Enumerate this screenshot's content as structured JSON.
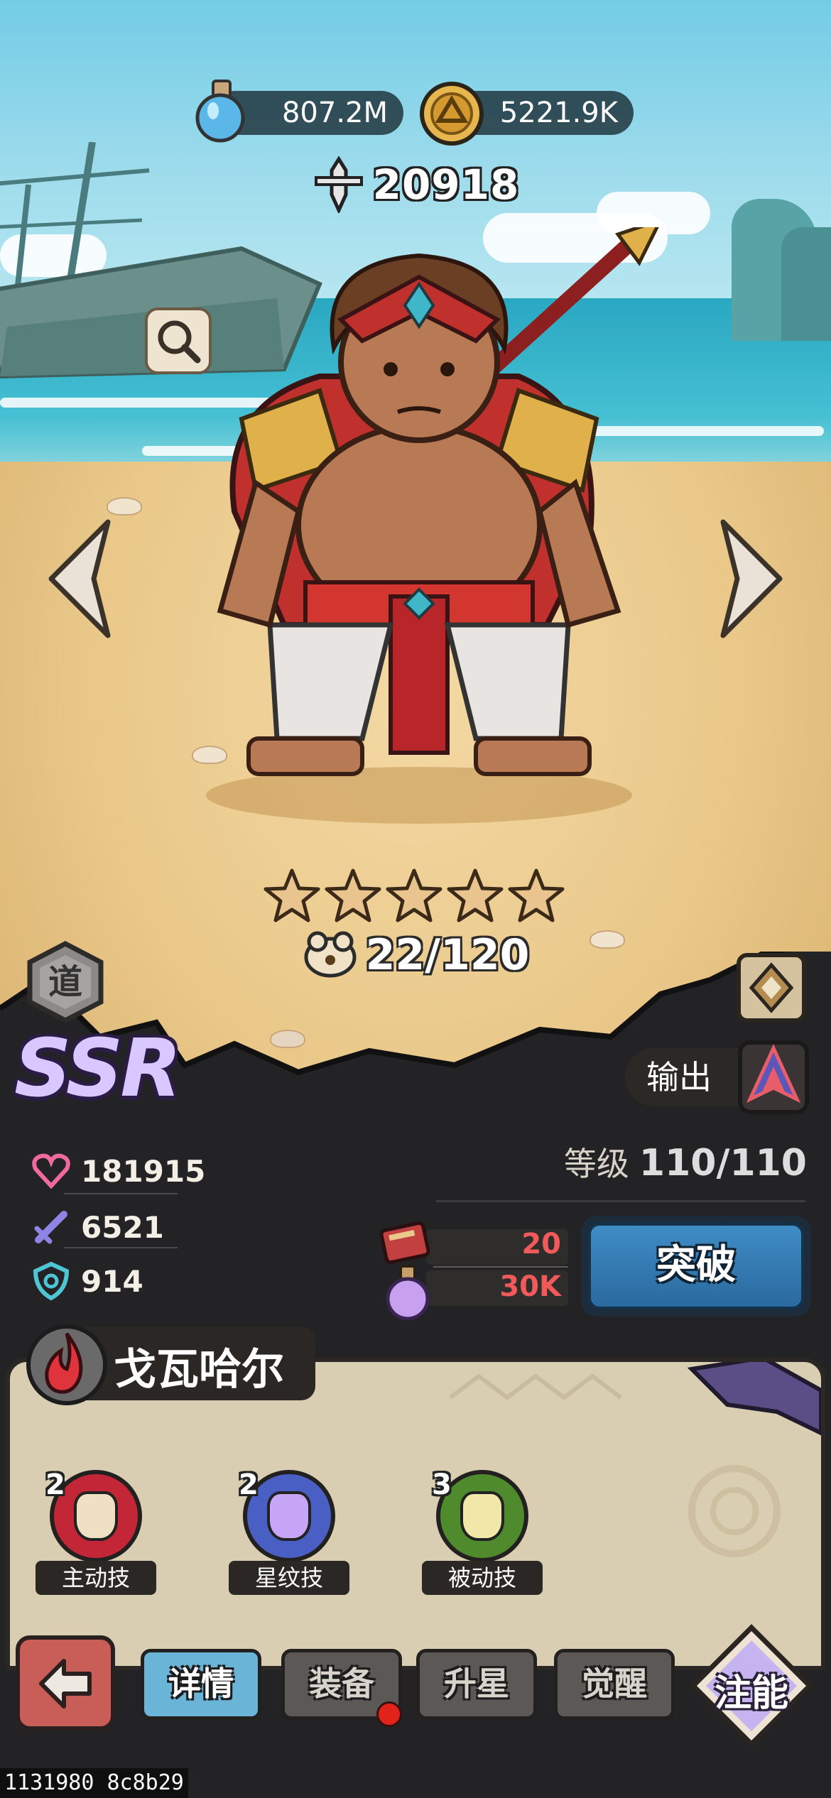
{
  "resources": {
    "potion": {
      "icon": "potion-flask-icon",
      "value": "807.2M"
    },
    "gold": {
      "icon": "gold-coin-icon",
      "value": "5221.9K"
    }
  },
  "hero": {
    "power": "20918",
    "stars": 5,
    "shards": "22/120",
    "faction_badge": "道",
    "rarity": "SSR",
    "role": "输出",
    "name": "戈瓦哈尔"
  },
  "stats": {
    "level_label": "等级",
    "level_value": "110/110",
    "hp": "181915",
    "attack": "6521",
    "defense": "914"
  },
  "breakthrough": {
    "book_cost": "20",
    "gold_cost": "30K",
    "button_label": "突破"
  },
  "skills": [
    {
      "level": "2",
      "label": "主动技",
      "icon": "horn-skill-icon"
    },
    {
      "level": "2",
      "label": "星纹技",
      "icon": "crystal-skill-icon"
    },
    {
      "level": "3",
      "label": "被动技",
      "icon": "lightbulb-skill-icon"
    }
  ],
  "tabs": [
    {
      "label": "详情",
      "active": true
    },
    {
      "label": "装备",
      "active": false
    },
    {
      "label": "升星",
      "active": false
    },
    {
      "label": "觉醒",
      "active": false
    }
  ],
  "inject_button": "注能",
  "footer_id": "1131980 8c8b29",
  "colors": {
    "accent_blue": "#3f8cc4",
    "cost_red": "#f05a5a",
    "panel_dark": "#2a2724",
    "sand": "#e9c889"
  }
}
